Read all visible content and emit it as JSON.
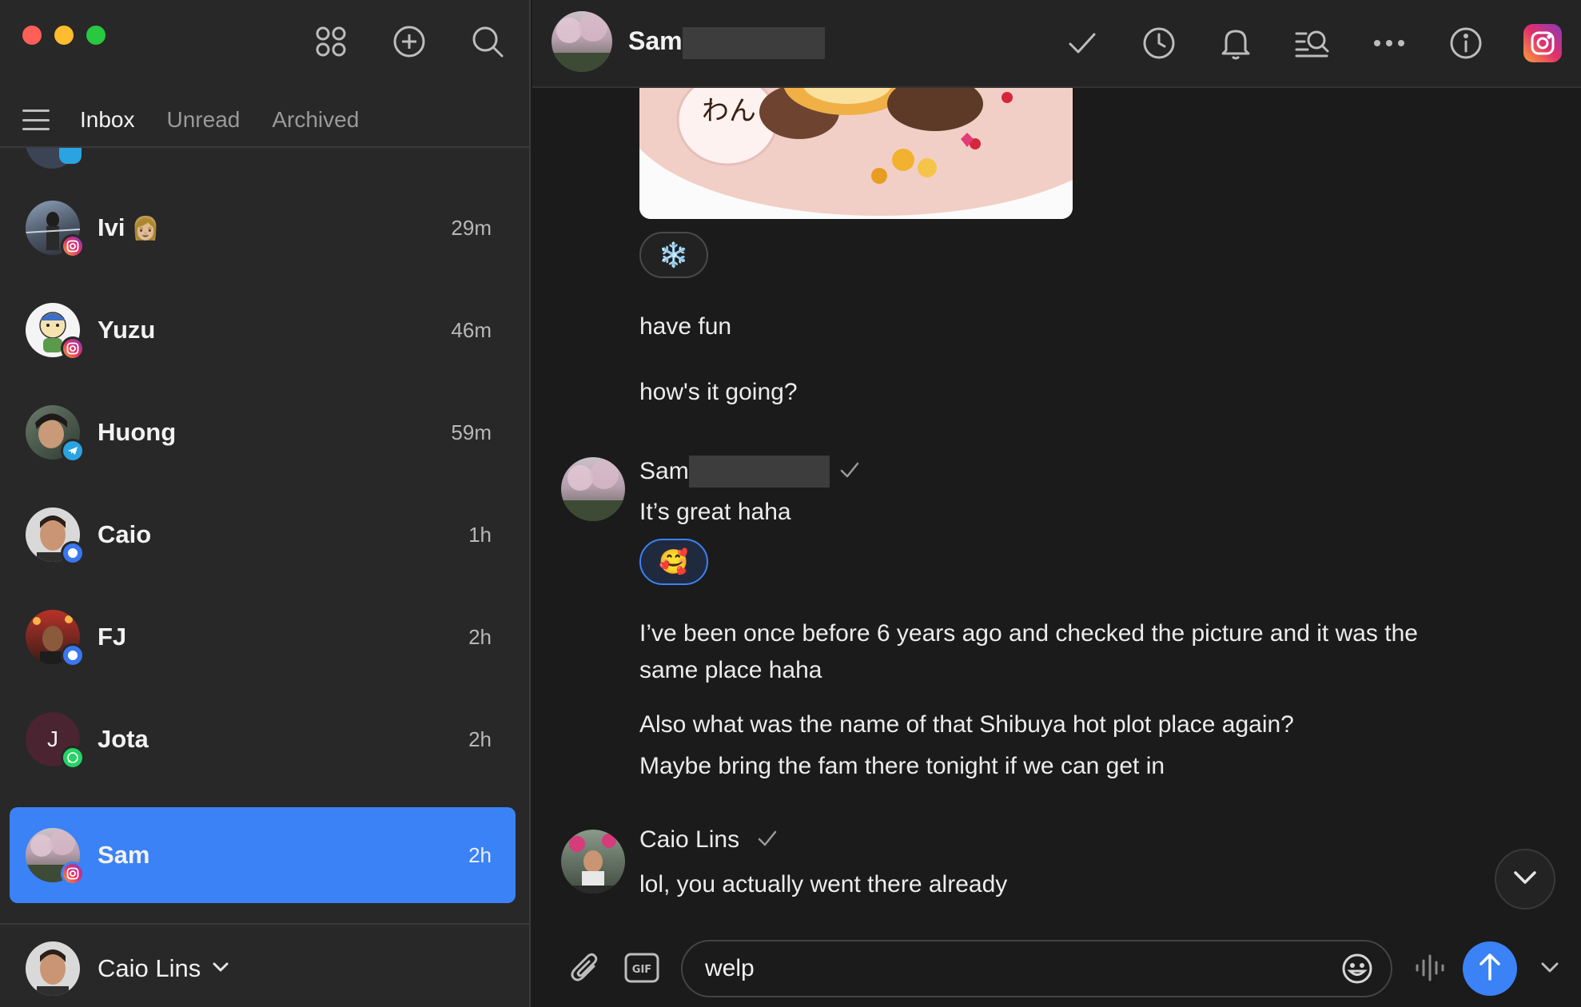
{
  "sidebar": {
    "tabs": [
      {
        "label": "Inbox",
        "active": true
      },
      {
        "label": "Unread",
        "active": false
      },
      {
        "label": "Archived",
        "active": false
      }
    ],
    "chats": [
      {
        "name": "Ivi",
        "emoji": "👩🏼",
        "time": "29m",
        "network": "instagram"
      },
      {
        "name": "Yuzu",
        "emoji": "",
        "time": "46m",
        "network": "instagram"
      },
      {
        "name": "Huong",
        "emoji": "",
        "time": "59m",
        "network": "telegram"
      },
      {
        "name": "Caio",
        "emoji": "",
        "time": "1h",
        "network": "signal"
      },
      {
        "name": "FJ",
        "emoji": "",
        "time": "2h",
        "network": "signal"
      },
      {
        "name": "Jota",
        "emoji": "",
        "time": "2h",
        "network": "whatsapp",
        "initial": "J"
      },
      {
        "name": "Sam",
        "emoji": "",
        "time": "2h",
        "network": "instagram",
        "selected": true
      }
    ],
    "account": {
      "name": "Caio Lins"
    }
  },
  "header": {
    "name": "Sam",
    "icons": [
      "check-icon",
      "clock-icon",
      "bell-icon",
      "search-messages-icon",
      "more-icon",
      "info-icon",
      "instagram-icon"
    ]
  },
  "messages": {
    "reaction_1": "❄️",
    "text_1": "have fun",
    "text_2": "how's it going?",
    "sender_1": "Sam",
    "text_3": "It’s great haha",
    "reaction_2": "🥰",
    "text_4a": "I’ve been once before 6 years ago and checked the picture and it was the",
    "text_4b": "same place haha",
    "text_5": "Also what was the name of that Shibuya hot plot place again?",
    "text_6": "Maybe bring the fam there tonight if we can get in",
    "sender_2": "Caio Lins",
    "text_7": "lol, you actually went there already"
  },
  "composer": {
    "value": "welp",
    "gif_label": "GIF"
  },
  "colors": {
    "accent": "#3b82f6",
    "sidebar_bg": "#282828",
    "main_bg": "#1b1b1b"
  }
}
